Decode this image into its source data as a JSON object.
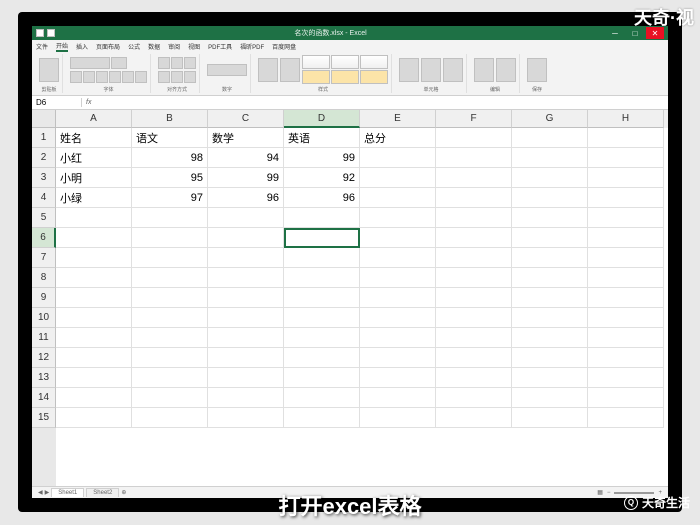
{
  "watermarks": {
    "topRight": "天奇·视",
    "bottomRight": "天奇生活"
  },
  "caption": "打开excel表格",
  "titlebar": {
    "filename": "名次的函数.xlsx - Excel"
  },
  "menubar": [
    "文件",
    "开始",
    "插入",
    "页面布局",
    "公式",
    "数据",
    "审阅",
    "视图",
    "PDF工具",
    "福昕PDF",
    "百度网盘"
  ],
  "ribbon": {
    "groups": [
      "剪贴板",
      "字体",
      "对齐方式",
      "数字",
      "样式",
      "单元格",
      "编辑",
      "保存"
    ]
  },
  "namebox": "D6",
  "columns": [
    "A",
    "B",
    "C",
    "D",
    "E",
    "F",
    "G",
    "H"
  ],
  "rowCount": 15,
  "headers": [
    "姓名",
    "语文",
    "数学",
    "英语",
    "总分"
  ],
  "rows": [
    {
      "name": "小红",
      "vals": [
        "98",
        "94",
        "99"
      ]
    },
    {
      "name": "小明",
      "vals": [
        "95",
        "99",
        "92"
      ]
    },
    {
      "name": "小绿",
      "vals": [
        "97",
        "96",
        "96"
      ]
    }
  ],
  "activeCell": {
    "row": 6,
    "col": "D"
  },
  "sheets": [
    "Sheet1",
    "Sheet2"
  ],
  "chart_data": {
    "type": "table",
    "columns": [
      "姓名",
      "语文",
      "数学",
      "英语",
      "总分"
    ],
    "data": [
      [
        "小红",
        98,
        94,
        99,
        null
      ],
      [
        "小明",
        95,
        99,
        92,
        null
      ],
      [
        "小绿",
        97,
        96,
        96,
        null
      ]
    ]
  }
}
